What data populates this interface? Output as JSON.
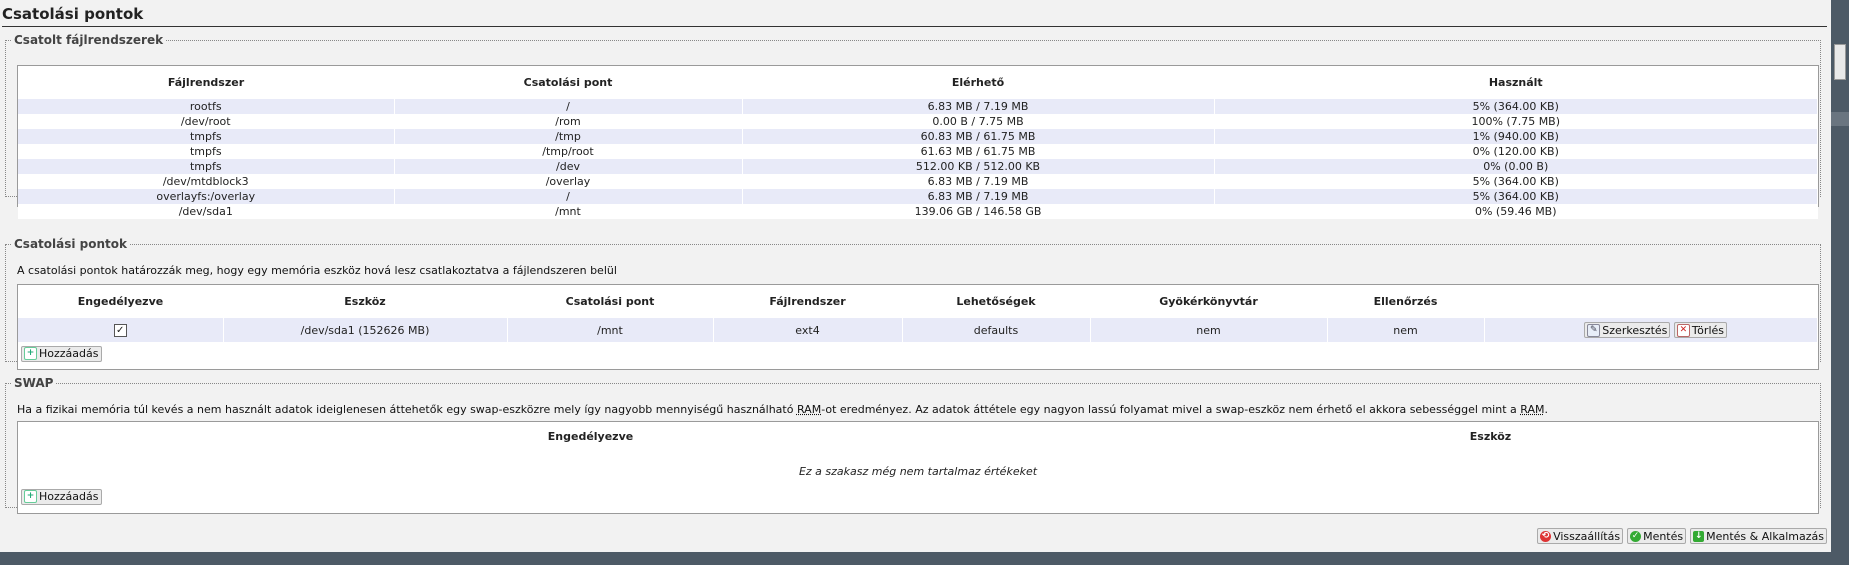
{
  "page_title": "Csatolási pontok",
  "mounted": {
    "legend": "Csatolt fájlrendszerek",
    "columns": [
      "Fájlrendszer",
      "Csatolási pont",
      "Elérhető",
      "Használt"
    ],
    "rows": [
      [
        "rootfs",
        "/",
        "6.83 MB / 7.19 MB",
        "5% (364.00 KB)"
      ],
      [
        "/dev/root",
        "/rom",
        "0.00 B / 7.75 MB",
        "100% (7.75 MB)"
      ],
      [
        "tmpfs",
        "/tmp",
        "60.83 MB / 61.75 MB",
        "1% (940.00 KB)"
      ],
      [
        "tmpfs",
        "/tmp/root",
        "61.63 MB / 61.75 MB",
        "0% (120.00 KB)"
      ],
      [
        "tmpfs",
        "/dev",
        "512.00 KB / 512.00 KB",
        "0% (0.00 B)"
      ],
      [
        "/dev/mtdblock3",
        "/overlay",
        "6.83 MB / 7.19 MB",
        "5% (364.00 KB)"
      ],
      [
        "overlayfs:/overlay",
        "/",
        "6.83 MB / 7.19 MB",
        "5% (364.00 KB)"
      ],
      [
        "/dev/sda1",
        "/mnt",
        "139.06 GB / 146.58 GB",
        "0% (59.46 MB)"
      ]
    ]
  },
  "mountpoints": {
    "legend": "Csatolási pontok",
    "description": "A csatolási pontok határozzák meg, hogy egy memória eszköz hová lesz csatlakoztatva a fájlendszeren belül",
    "columns": [
      "Engedélyezve",
      "Eszköz",
      "Csatolási pont",
      "Fájlrendszer",
      "Lehetőségek",
      "Gyökérkönyvtár",
      "Ellenőrzés"
    ],
    "row": {
      "enabled": "✓",
      "device": "/dev/sda1 (152626 MB)",
      "target": "/mnt",
      "fstype": "ext4",
      "options": "defaults",
      "root": "nem",
      "check": "nem"
    },
    "edit_label": "Szerkesztés",
    "delete_label": "Törlés",
    "add_label": "Hozzáadás"
  },
  "swap": {
    "legend": "SWAP",
    "desc_part1": "Ha a fizikai memória túl kevés a nem használt adatok ideiglenesen áttehetők egy swap-eszközre mely így nagyobb mennyiségű használható ",
    "desc_abbr1": "RAM",
    "desc_part2": "-ot eredményez. Az adatok áttétele egy nagyon lassú folyamat mivel a swap-eszköz nem érhető el akkora sebességgel mint a ",
    "desc_abbr2": "RAM",
    "desc_part3": ".",
    "columns": [
      "Engedélyezve",
      "Eszköz"
    ],
    "empty": "Ez a szakasz még nem tartalmaz értékeket",
    "add_label": "Hozzáadás"
  },
  "footer": {
    "reset_label": "Visszaállítás",
    "save_label": "Mentés",
    "apply_label": "Mentés & Alkalmazás"
  }
}
